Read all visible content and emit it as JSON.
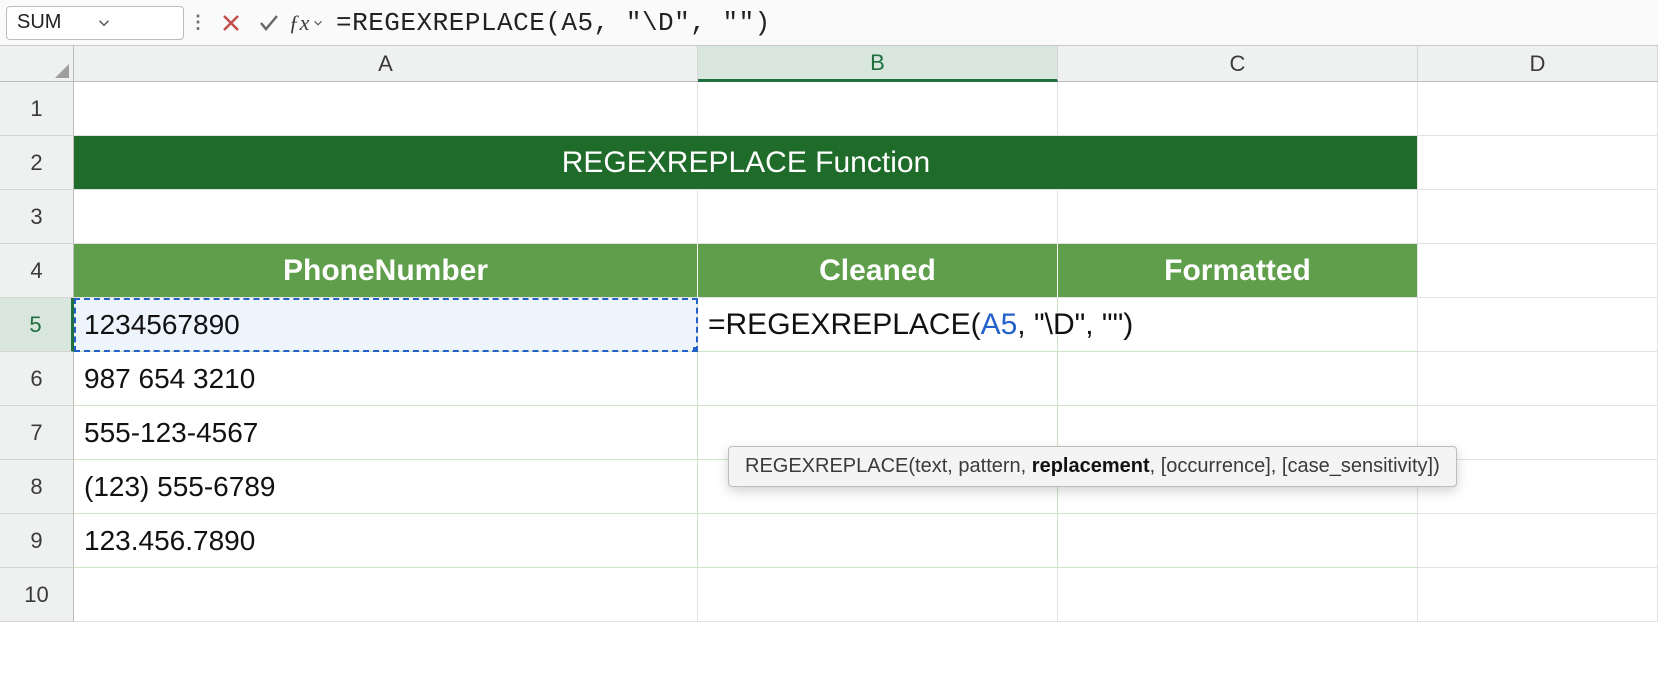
{
  "nameBox": "SUM",
  "formulaBar": "=REGEXREPLACE(A5, \"\\D\", \"\")",
  "columns": [
    "A",
    "B",
    "C",
    "D"
  ],
  "activeColumn": "B",
  "rows": [
    "1",
    "2",
    "3",
    "4",
    "5",
    "6",
    "7",
    "8",
    "9",
    "10"
  ],
  "activeRow": "5",
  "banner": "REGEXREPLACE Function",
  "headers": {
    "A": "PhoneNumber",
    "B": "Cleaned",
    "C": "Formatted"
  },
  "data": {
    "5": {
      "A": "1234567890"
    },
    "6": {
      "A": "987 654 3210"
    },
    "7": {
      "A": "555-123-4567"
    },
    "8": {
      "A": "(123) 555-6789"
    },
    "9": {
      "A": "123.456.7890"
    }
  },
  "editingFormula": {
    "prefix": "=REGEXREPLACE(",
    "ref": "A5",
    "suffix": ", \"\\D\", \"\")"
  },
  "tooltip": {
    "fn": "REGEXREPLACE",
    "args_before": "(text, pattern, ",
    "arg_bold": "replacement",
    "args_after": ", [occurrence], [case_sensitivity])"
  },
  "chart_data": {
    "type": "table",
    "title": "REGEXREPLACE Function",
    "columns": [
      "PhoneNumber",
      "Cleaned",
      "Formatted"
    ],
    "rows": [
      [
        "1234567890",
        "=REGEXREPLACE(A5, \"\\D\", \"\")",
        ""
      ],
      [
        "987 654 3210",
        "",
        ""
      ],
      [
        "555-123-4567",
        "",
        ""
      ],
      [
        "(123) 555-6789",
        "",
        ""
      ],
      [
        "123.456.7890",
        "",
        ""
      ]
    ]
  }
}
